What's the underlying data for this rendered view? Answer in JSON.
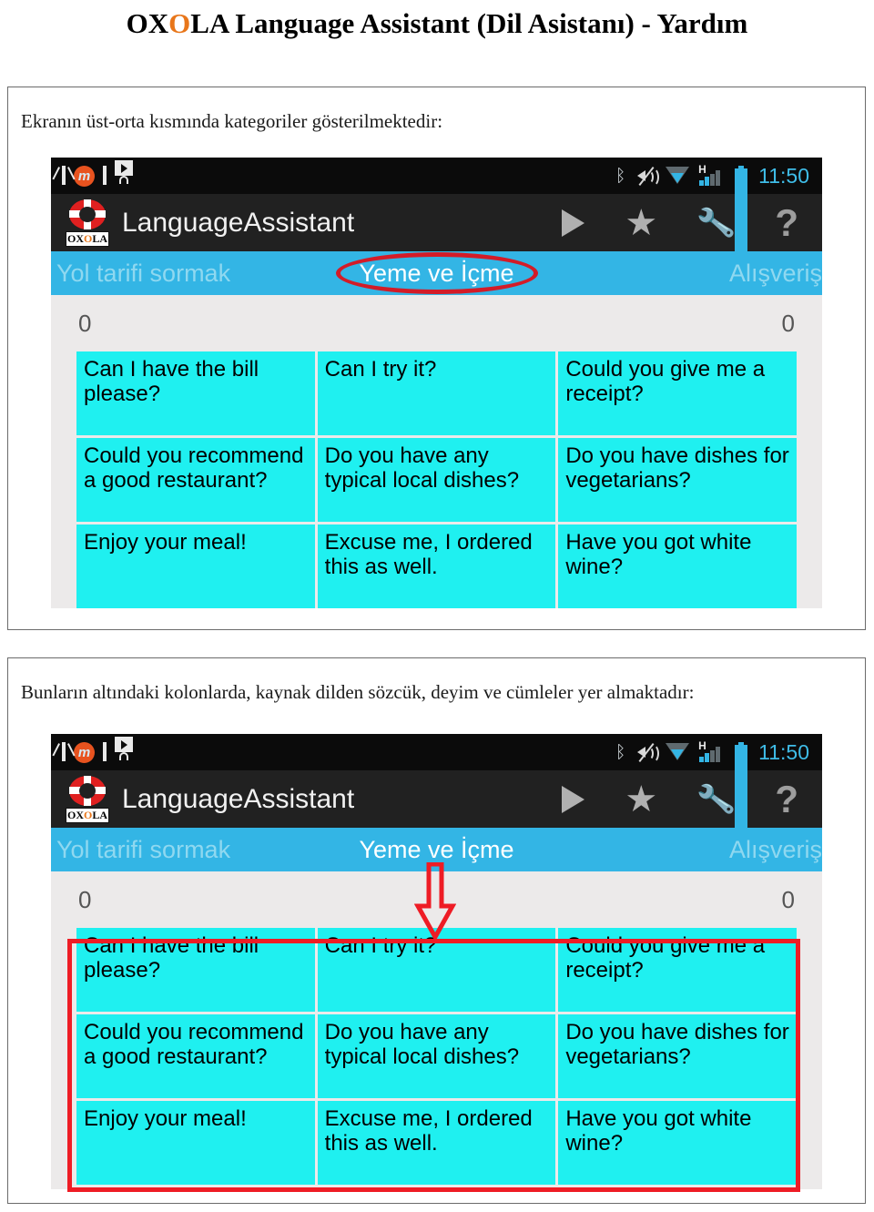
{
  "document": {
    "title_parts": {
      "before": "OX",
      "highlight": "O",
      "after": "LA Language Assistant (Dil Asistanı) - Yardım"
    },
    "title_full": "OXOLA Language Assistant (Dil Asistanı) - Yardım"
  },
  "sections": [
    {
      "caption": "Ekranın üst-orta kısmında kategoriler gösterilmektedir:"
    },
    {
      "caption": "Bunların altındaki kolonlarda, kaynak dilden sözcük, deyim ve cümleler yer almaktadır:"
    }
  ],
  "screenshot": {
    "statusbar": {
      "left_icons": [
        "gmail-icon",
        "mm-app-icon",
        "gallery-icon",
        "play-store-icon"
      ],
      "right_icons": [
        "bluetooth-icon",
        "volume-muted-icon",
        "wifi-icon",
        "hspa-signal-icon",
        "battery-icon"
      ],
      "signal_label": "H",
      "bluetooth_glyph": "ᛒ",
      "clock": "11:50"
    },
    "appbar": {
      "logo_name": "oxola-lifebuoy-logo",
      "logo_plate_before": "OX",
      "logo_plate_highlight": "O",
      "logo_plate_after": "LA",
      "title": "LanguageAssistant",
      "actions": [
        {
          "name": "play-icon",
          "label": ""
        },
        {
          "name": "star-icon",
          "glyph": "★"
        },
        {
          "name": "wrench-icon",
          "glyph": "🔧"
        },
        {
          "name": "help-icon",
          "glyph": "?"
        }
      ]
    },
    "tabs": {
      "previous": "Yol tarifi sormak",
      "current": "Yeme ve İçme",
      "next": "Alışveriş"
    },
    "counters": {
      "left": "0",
      "right": "0"
    },
    "grid": {
      "rows": [
        [
          "Can I have the bill please?",
          "Can I try it?",
          "Could you give me a receipt?"
        ],
        [
          "Could you recommend a good restaurant?",
          "Do you have any typical local dishes?",
          "Do you have dishes for vegetarians?"
        ],
        [
          "Enjoy your meal!",
          "Excuse me, I ordered this as well.",
          "Have you got white wine?"
        ]
      ]
    }
  },
  "annotations": {
    "ellipse_target": "Yeme ve İçme",
    "arrow_direction": "down",
    "highlight_color": "#EE1C25",
    "ellipse_color": "#D31C28"
  },
  "colors": {
    "tab_bar": "#33B5E5",
    "cell_cyan": "#1FF0F0",
    "statusbar": "#0b0b0b",
    "appbar": "#212121",
    "brand_orange": "#E8761A",
    "annotation_red": "#EE1C25",
    "clock_blue": "#3fbde8"
  }
}
